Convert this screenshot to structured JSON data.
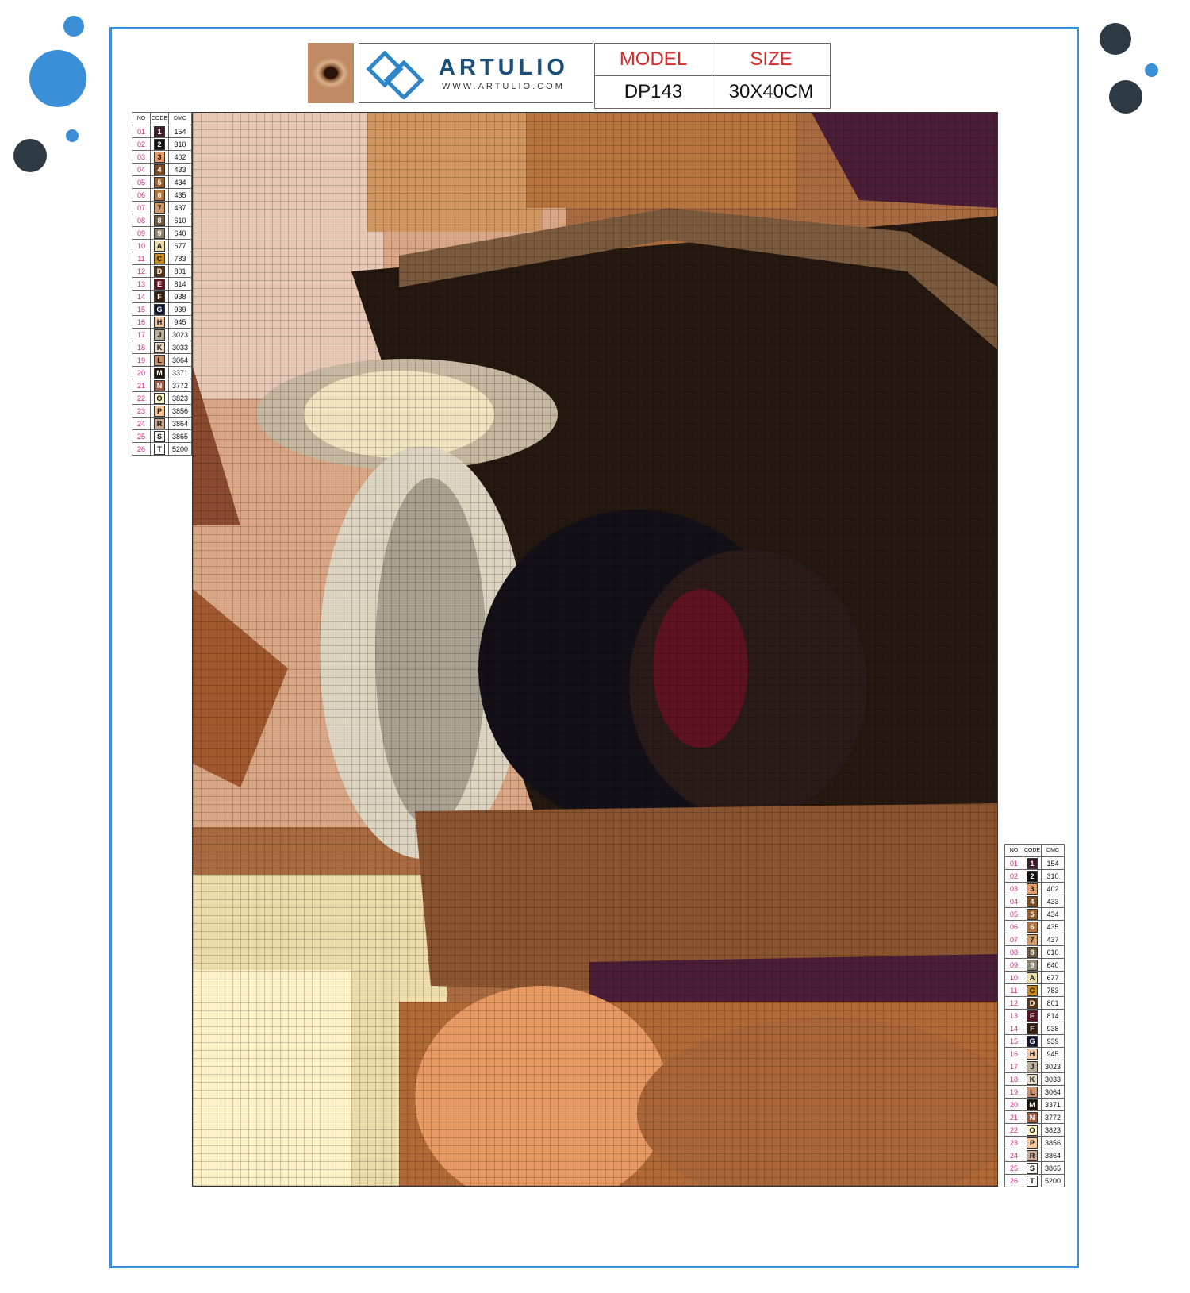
{
  "header": {
    "brand": "ARTULIO",
    "website": "WWW.ARTULIO.COM",
    "model_label": "MODEL",
    "model_value": "DP143",
    "size_label": "SIZE",
    "size_value": "30X40CM"
  },
  "colors": {
    "accent_blue": "#3a8fd6",
    "dark_dot": "#2d3a44",
    "header_red": "#d42a2a",
    "legend_number": "#d61e8c"
  },
  "legend": {
    "headers": [
      "NO",
      "CODE",
      "DMC"
    ],
    "rows": [
      {
        "no": "01",
        "code": "1",
        "dmc": "154",
        "color": "#3e1d2e"
      },
      {
        "no": "02",
        "code": "2",
        "dmc": "310",
        "color": "#111111"
      },
      {
        "no": "03",
        "code": "3",
        "dmc": "402",
        "color": "#e89a64"
      },
      {
        "no": "04",
        "code": "4",
        "dmc": "433",
        "color": "#7a4a22"
      },
      {
        "no": "05",
        "code": "5",
        "dmc": "434",
        "color": "#96602e"
      },
      {
        "no": "06",
        "code": "6",
        "dmc": "435",
        "color": "#b4743e"
      },
      {
        "no": "07",
        "code": "7",
        "dmc": "437",
        "color": "#cf9a66"
      },
      {
        "no": "08",
        "code": "8",
        "dmc": "610",
        "color": "#6e5a3e"
      },
      {
        "no": "09",
        "code": "9",
        "dmc": "640",
        "color": "#8e8670"
      },
      {
        "no": "10",
        "code": "A",
        "dmc": "677",
        "color": "#ecdcaa"
      },
      {
        "no": "11",
        "code": "C",
        "dmc": "783",
        "color": "#c88a1e"
      },
      {
        "no": "12",
        "code": "D",
        "dmc": "801",
        "color": "#5a3416"
      },
      {
        "no": "13",
        "code": "E",
        "dmc": "814",
        "color": "#5e1420"
      },
      {
        "no": "14",
        "code": "F",
        "dmc": "938",
        "color": "#341e0e"
      },
      {
        "no": "15",
        "code": "G",
        "dmc": "939",
        "color": "#10162c"
      },
      {
        "no": "16",
        "code": "H",
        "dmc": "945",
        "color": "#f2c8a4"
      },
      {
        "no": "17",
        "code": "J",
        "dmc": "3023",
        "color": "#b6ae96"
      },
      {
        "no": "18",
        "code": "K",
        "dmc": "3033",
        "color": "#e8dcc8"
      },
      {
        "no": "19",
        "code": "L",
        "dmc": "3064",
        "color": "#c8906e"
      },
      {
        "no": "20",
        "code": "M",
        "dmc": "3371",
        "color": "#1e1208"
      },
      {
        "no": "21",
        "code": "N",
        "dmc": "3772",
        "color": "#9a5e48"
      },
      {
        "no": "22",
        "code": "O",
        "dmc": "3823",
        "color": "#fff6cc"
      },
      {
        "no": "23",
        "code": "P",
        "dmc": "3856",
        "color": "#f8c89a"
      },
      {
        "no": "24",
        "code": "R",
        "dmc": "3864",
        "color": "#c8a890"
      },
      {
        "no": "25",
        "code": "S",
        "dmc": "3865",
        "color": "#fafaf4"
      },
      {
        "no": "26",
        "code": "T",
        "dmc": "5200",
        "color": "#ffffff"
      }
    ]
  }
}
